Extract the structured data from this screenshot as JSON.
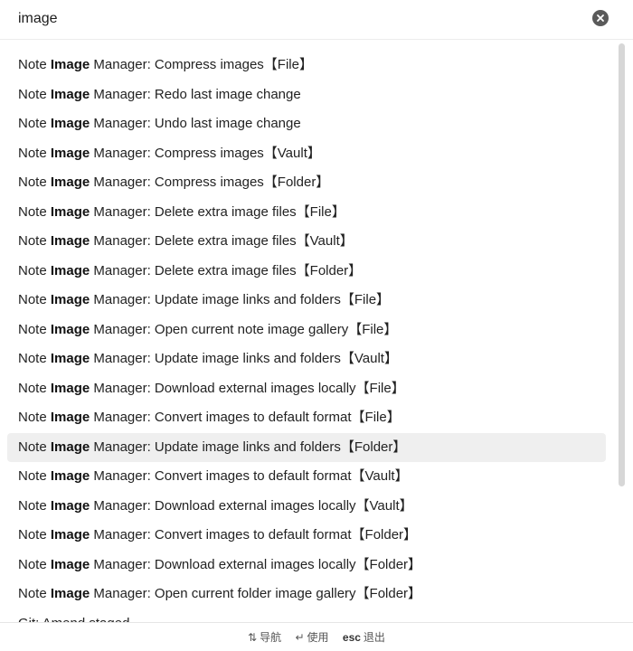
{
  "search": {
    "value": "image",
    "placeholder": ""
  },
  "results": [
    {
      "prefix": "Note ",
      "match": "Image",
      "suffix": " Manager: Compress images【File】"
    },
    {
      "prefix": "Note ",
      "match": "Image",
      "suffix": " Manager: Redo last image change"
    },
    {
      "prefix": "Note ",
      "match": "Image",
      "suffix": " Manager: Undo last image change"
    },
    {
      "prefix": "Note ",
      "match": "Image",
      "suffix": " Manager: Compress images【Vault】"
    },
    {
      "prefix": "Note ",
      "match": "Image",
      "suffix": " Manager: Compress images【Folder】"
    },
    {
      "prefix": "Note ",
      "match": "Image",
      "suffix": " Manager: Delete extra image files【File】"
    },
    {
      "prefix": "Note ",
      "match": "Image",
      "suffix": " Manager: Delete extra image files【Vault】"
    },
    {
      "prefix": "Note ",
      "match": "Image",
      "suffix": " Manager: Delete extra image files【Folder】"
    },
    {
      "prefix": "Note ",
      "match": "Image",
      "suffix": " Manager: Update image links and folders【File】"
    },
    {
      "prefix": "Note ",
      "match": "Image",
      "suffix": " Manager: Open current note image gallery【File】"
    },
    {
      "prefix": "Note ",
      "match": "Image",
      "suffix": " Manager: Update image links and folders【Vault】"
    },
    {
      "prefix": "Note ",
      "match": "Image",
      "suffix": " Manager: Download external images locally【File】"
    },
    {
      "prefix": "Note ",
      "match": "Image",
      "suffix": " Manager: Convert images to default format【File】"
    },
    {
      "prefix": "Note ",
      "match": "Image",
      "suffix": " Manager: Update image links and folders【Folder】"
    },
    {
      "prefix": "Note ",
      "match": "Image",
      "suffix": " Manager: Convert images to default format【Vault】"
    },
    {
      "prefix": "Note ",
      "match": "Image",
      "suffix": " Manager: Download external images locally【Vault】"
    },
    {
      "prefix": "Note ",
      "match": "Image",
      "suffix": " Manager: Convert images to default format【Folder】"
    },
    {
      "prefix": "Note ",
      "match": "Image",
      "suffix": " Manager: Download external images locally【Folder】"
    },
    {
      "prefix": "Note ",
      "match": "Image",
      "suffix": " Manager: Open current folder image gallery【Folder】"
    },
    {
      "prefix": "Git: Amend staged",
      "match": "",
      "suffix": ""
    }
  ],
  "selected_index": 13,
  "footer": {
    "navigate_key": "⇅",
    "navigate_label": "导航",
    "use_key": "↵",
    "use_label": "使用",
    "exit_key": "esc",
    "exit_label": "退出"
  },
  "icons": {
    "clear": "clear-circle-icon"
  },
  "colors": {
    "selected_bg": "#efefef",
    "clear_btn": "#5a5a5a",
    "scrollbar": "#d7d7d7"
  }
}
